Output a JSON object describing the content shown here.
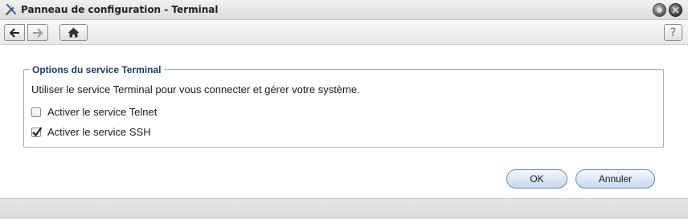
{
  "window": {
    "title": "Panneau de configuration - Terminal",
    "app_icon": "tools-icon",
    "minimize_icon": "minimize-icon",
    "close_icon": "close-icon"
  },
  "toolbar": {
    "back_icon": "arrow-left-icon",
    "forward_icon": "arrow-right-icon",
    "home_icon": "home-icon",
    "help_label": "?"
  },
  "group": {
    "legend": "Options du service Terminal",
    "description": "Utiliser le service Terminal pour vous connecter et gérer votre système.",
    "options": [
      {
        "label": "Activer le service Telnet",
        "checked": false
      },
      {
        "label": "Activer le service SSH",
        "checked": true
      }
    ]
  },
  "buttons": {
    "ok": "OK",
    "cancel": "Annuler"
  },
  "colors": {
    "legend": "#1e3a5f",
    "button_border": "#6c88b3",
    "fieldset_border": "#9fb2c7"
  }
}
